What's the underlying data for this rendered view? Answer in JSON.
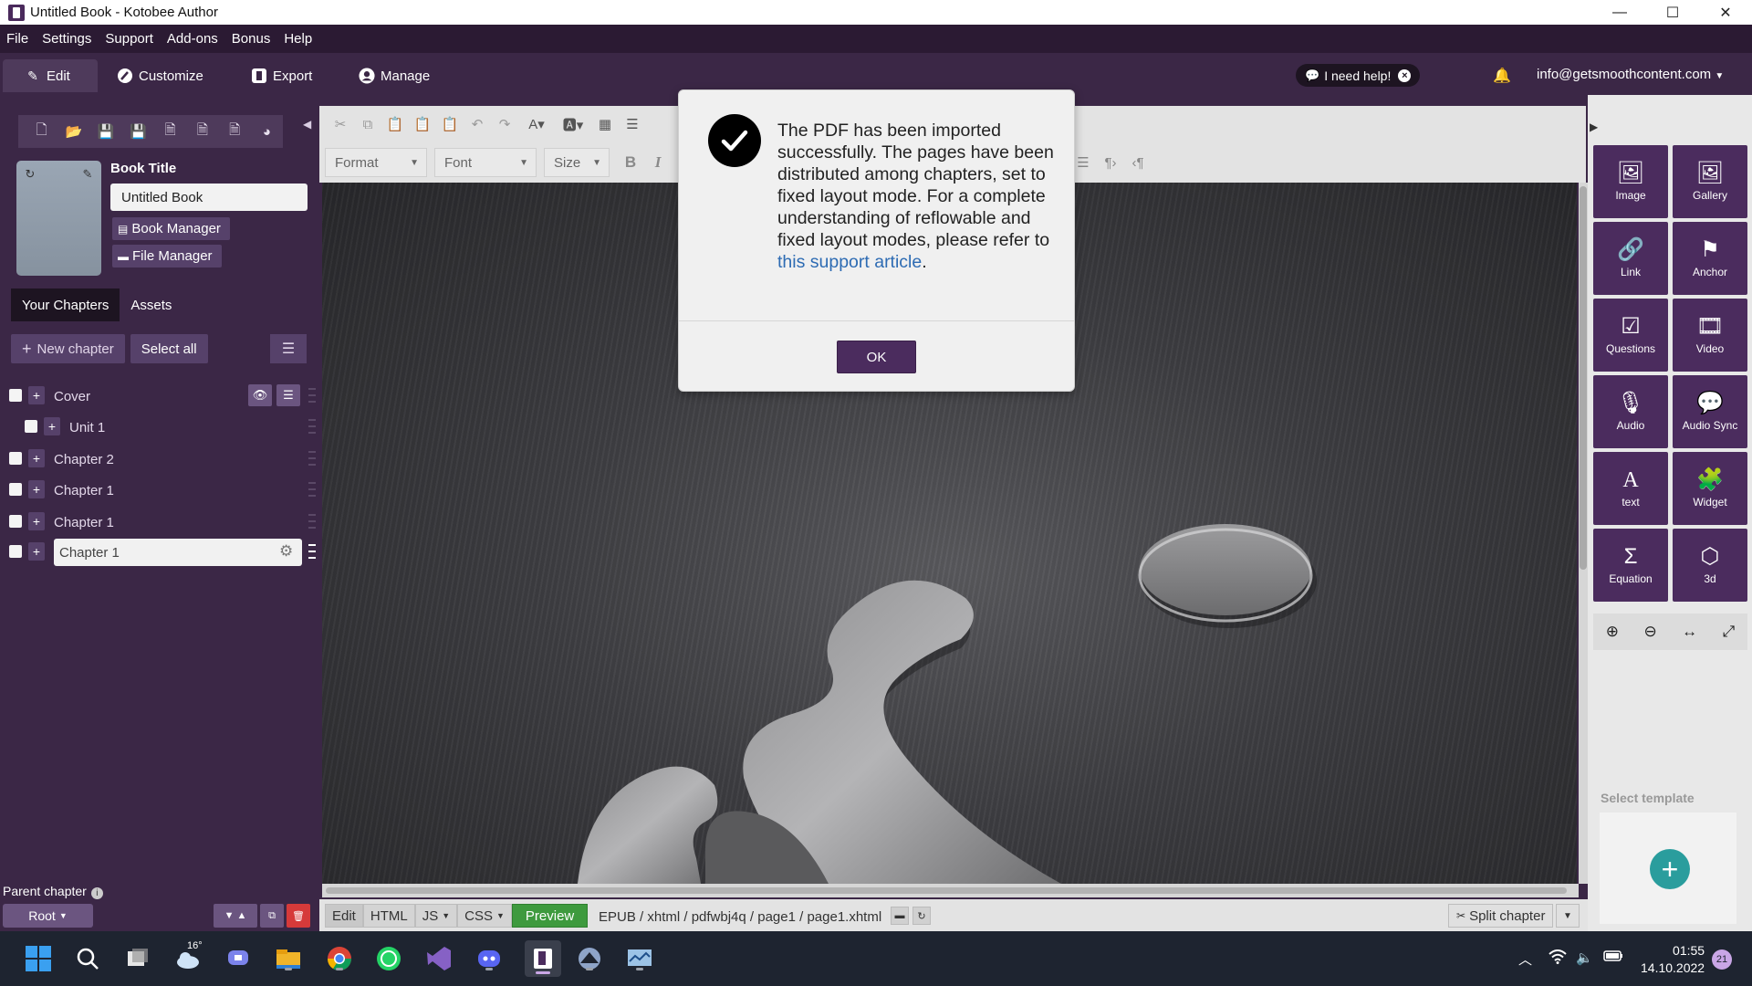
{
  "window": {
    "title": "Untitled Book - Kotobee Author",
    "controls": [
      "—",
      "☐",
      "✕"
    ]
  },
  "menu": [
    "File",
    "Settings",
    "Support",
    "Add-ons",
    "Bonus",
    "Help"
  ],
  "tabs": {
    "edit": "Edit",
    "customize": "Customize",
    "export": "Export",
    "manage": "Manage"
  },
  "help": {
    "label": "I need help!"
  },
  "account": {
    "email": "info@getsmoothcontent.com"
  },
  "sidebar": {
    "book_title_label": "Book Title",
    "book_title_value": "Untitled Book",
    "book_manager": "Book Manager",
    "file_manager": "File Manager",
    "tabs": [
      "Your Chapters",
      "Assets"
    ],
    "new_chapter": "New chapter",
    "select_all": "Select all",
    "chapters": [
      {
        "name": "Cover",
        "level": 0
      },
      {
        "name": "Unit 1",
        "level": 1
      },
      {
        "name": "Chapter 2",
        "level": 0
      },
      {
        "name": "Chapter 1",
        "level": 0
      },
      {
        "name": "Chapter 1",
        "level": 0
      },
      {
        "name": "Chapter 1",
        "level": 0,
        "selected": true
      }
    ],
    "parent_chapter_label": "Parent chapter",
    "root_label": "Root"
  },
  "editor": {
    "format": "Format",
    "font": "Font",
    "size": "Size",
    "bold": "B",
    "italic": "I"
  },
  "statusbar": {
    "tabs": [
      "Edit",
      "HTML",
      "JS",
      "CSS",
      "Preview"
    ],
    "path": "EPUB / xhtml / pdfwbj4q / page1 / page1.xhtml",
    "split_chapter": "Split chapter"
  },
  "tools": [
    {
      "label": "Image",
      "icon": "image-icon"
    },
    {
      "label": "Gallery",
      "icon": "gallery-icon"
    },
    {
      "label": "Link",
      "icon": "link-icon"
    },
    {
      "label": "Anchor",
      "icon": "anchor-flag-icon"
    },
    {
      "label": "Questions",
      "icon": "questions-icon"
    },
    {
      "label": "Video",
      "icon": "video-icon"
    },
    {
      "label": "Audio",
      "icon": "microphone-icon"
    },
    {
      "label": "Audio Sync",
      "icon": "audio-sync-icon"
    },
    {
      "label": "text",
      "icon": "text-icon"
    },
    {
      "label": "Widget",
      "icon": "widget-icon"
    },
    {
      "label": "Equation",
      "icon": "sigma-icon"
    },
    {
      "label": "3d",
      "icon": "cube-icon"
    }
  ],
  "template": {
    "label": "Select template"
  },
  "dialog": {
    "message": "The PDF has been imported successfully. The pages have been distributed among chapters, set to fixed layout mode. For a complete understanding of reflowable and fixed layout modes, please refer to",
    "link_text": "this support article",
    "message_end": ".",
    "ok": "OK"
  },
  "taskbar": {
    "weather_temp": "16°",
    "time": "01:55",
    "date": "14.10.2022",
    "notifications": "21"
  },
  "colors": {
    "sidebar_bg": "#3b2746",
    "accent_purple": "#4b2c5e",
    "preview_green": "#3e9a3e",
    "link_blue": "#2d6bb3",
    "template_teal": "#2a9d9d"
  }
}
